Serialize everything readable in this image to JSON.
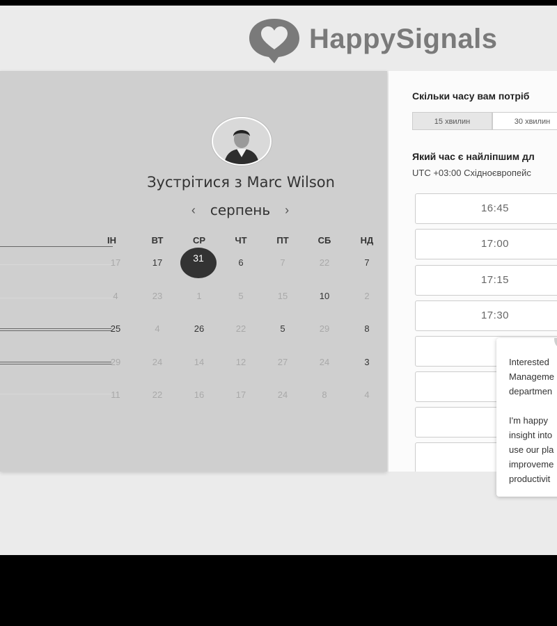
{
  "brand": {
    "name": "HappySignals"
  },
  "meeting": {
    "title": "Зустрітися з Marc Wilson"
  },
  "calendar": {
    "month": "серпень",
    "prev_label": "‹",
    "next_label": "›",
    "weekdays": [
      "ВТ",
      "СР",
      "ЧТ",
      "ПТ",
      "СБ",
      "НД"
    ],
    "weekday_partial": "ІН",
    "weeks": [
      [
        "17",
        "17",
        "31",
        "6",
        "7",
        "22",
        "7"
      ],
      [
        "4",
        "23",
        "1",
        "5",
        "15",
        "10",
        "2"
      ],
      [
        "25",
        "4",
        "26",
        "22",
        "5",
        "29",
        "8"
      ],
      [
        "29",
        "24",
        "14",
        "12",
        "27",
        "24",
        "3"
      ],
      [
        "11",
        "22",
        "16",
        "17",
        "24",
        "8",
        "4"
      ]
    ]
  },
  "duration": {
    "question": "Скільки часу вам потріб",
    "options": [
      "15 хвилин",
      "30 хвилин"
    ]
  },
  "times": {
    "question": "Який час є найліпшим дл",
    "timezone": "UTC +03:00 Східноєвропейс",
    "slots": [
      "16:45",
      "17:00",
      "17:15",
      "17:30",
      "",
      "",
      "",
      ""
    ]
  },
  "chat_popup": {
    "lines_1": [
      "Interested",
      "Manageme",
      "departmen"
    ],
    "lines_2": [
      "I'm happy",
      "insight into",
      "use our pla",
      "improveme",
      "productivit"
    ]
  }
}
